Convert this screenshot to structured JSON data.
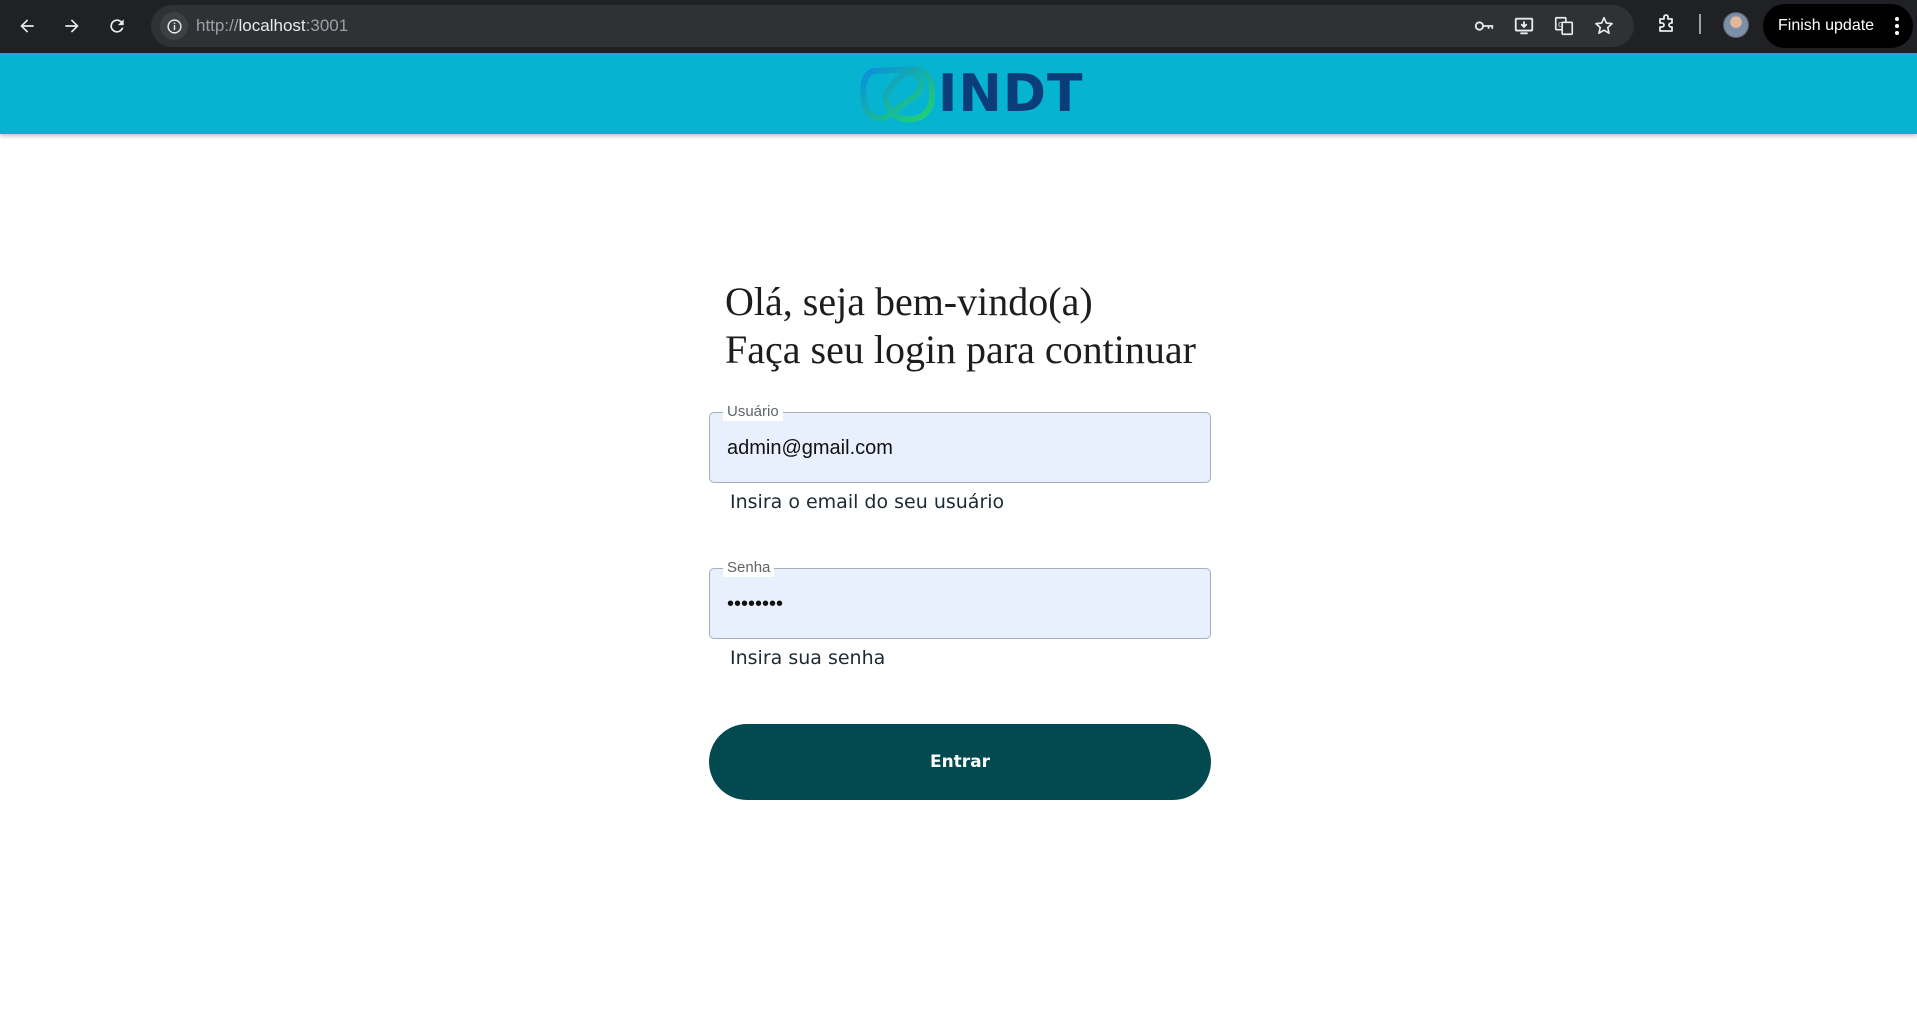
{
  "browser": {
    "url_scheme": "http://",
    "url_host": "localhost",
    "url_port": ":3001",
    "finish_update_label": "Finish update",
    "icons": [
      "back-icon",
      "forward-icon",
      "reload-icon",
      "site-info-icon",
      "password-key-icon",
      "install-app-icon",
      "translate-icon",
      "bookmark-star-icon",
      "extensions-icon",
      "profile-avatar",
      "more-menu-icon"
    ]
  },
  "header": {
    "logo_text": "INDT",
    "background_color": "#06b4d2",
    "logo_text_color": "#0b3d7a"
  },
  "login": {
    "heading_line1": "Olá, seja bem-vindo(a)",
    "heading_line2": "Faça seu login para continuar",
    "username": {
      "label": "Usuário",
      "value": "admin@gmail.com",
      "helper": "Insira o email do seu usuário"
    },
    "password": {
      "label": "Senha",
      "value": "••••••••",
      "helper": "Insira sua senha"
    },
    "submit_label": "Entrar",
    "submit_color": "#024a50",
    "field_fill_color": "#e8f0fe"
  }
}
